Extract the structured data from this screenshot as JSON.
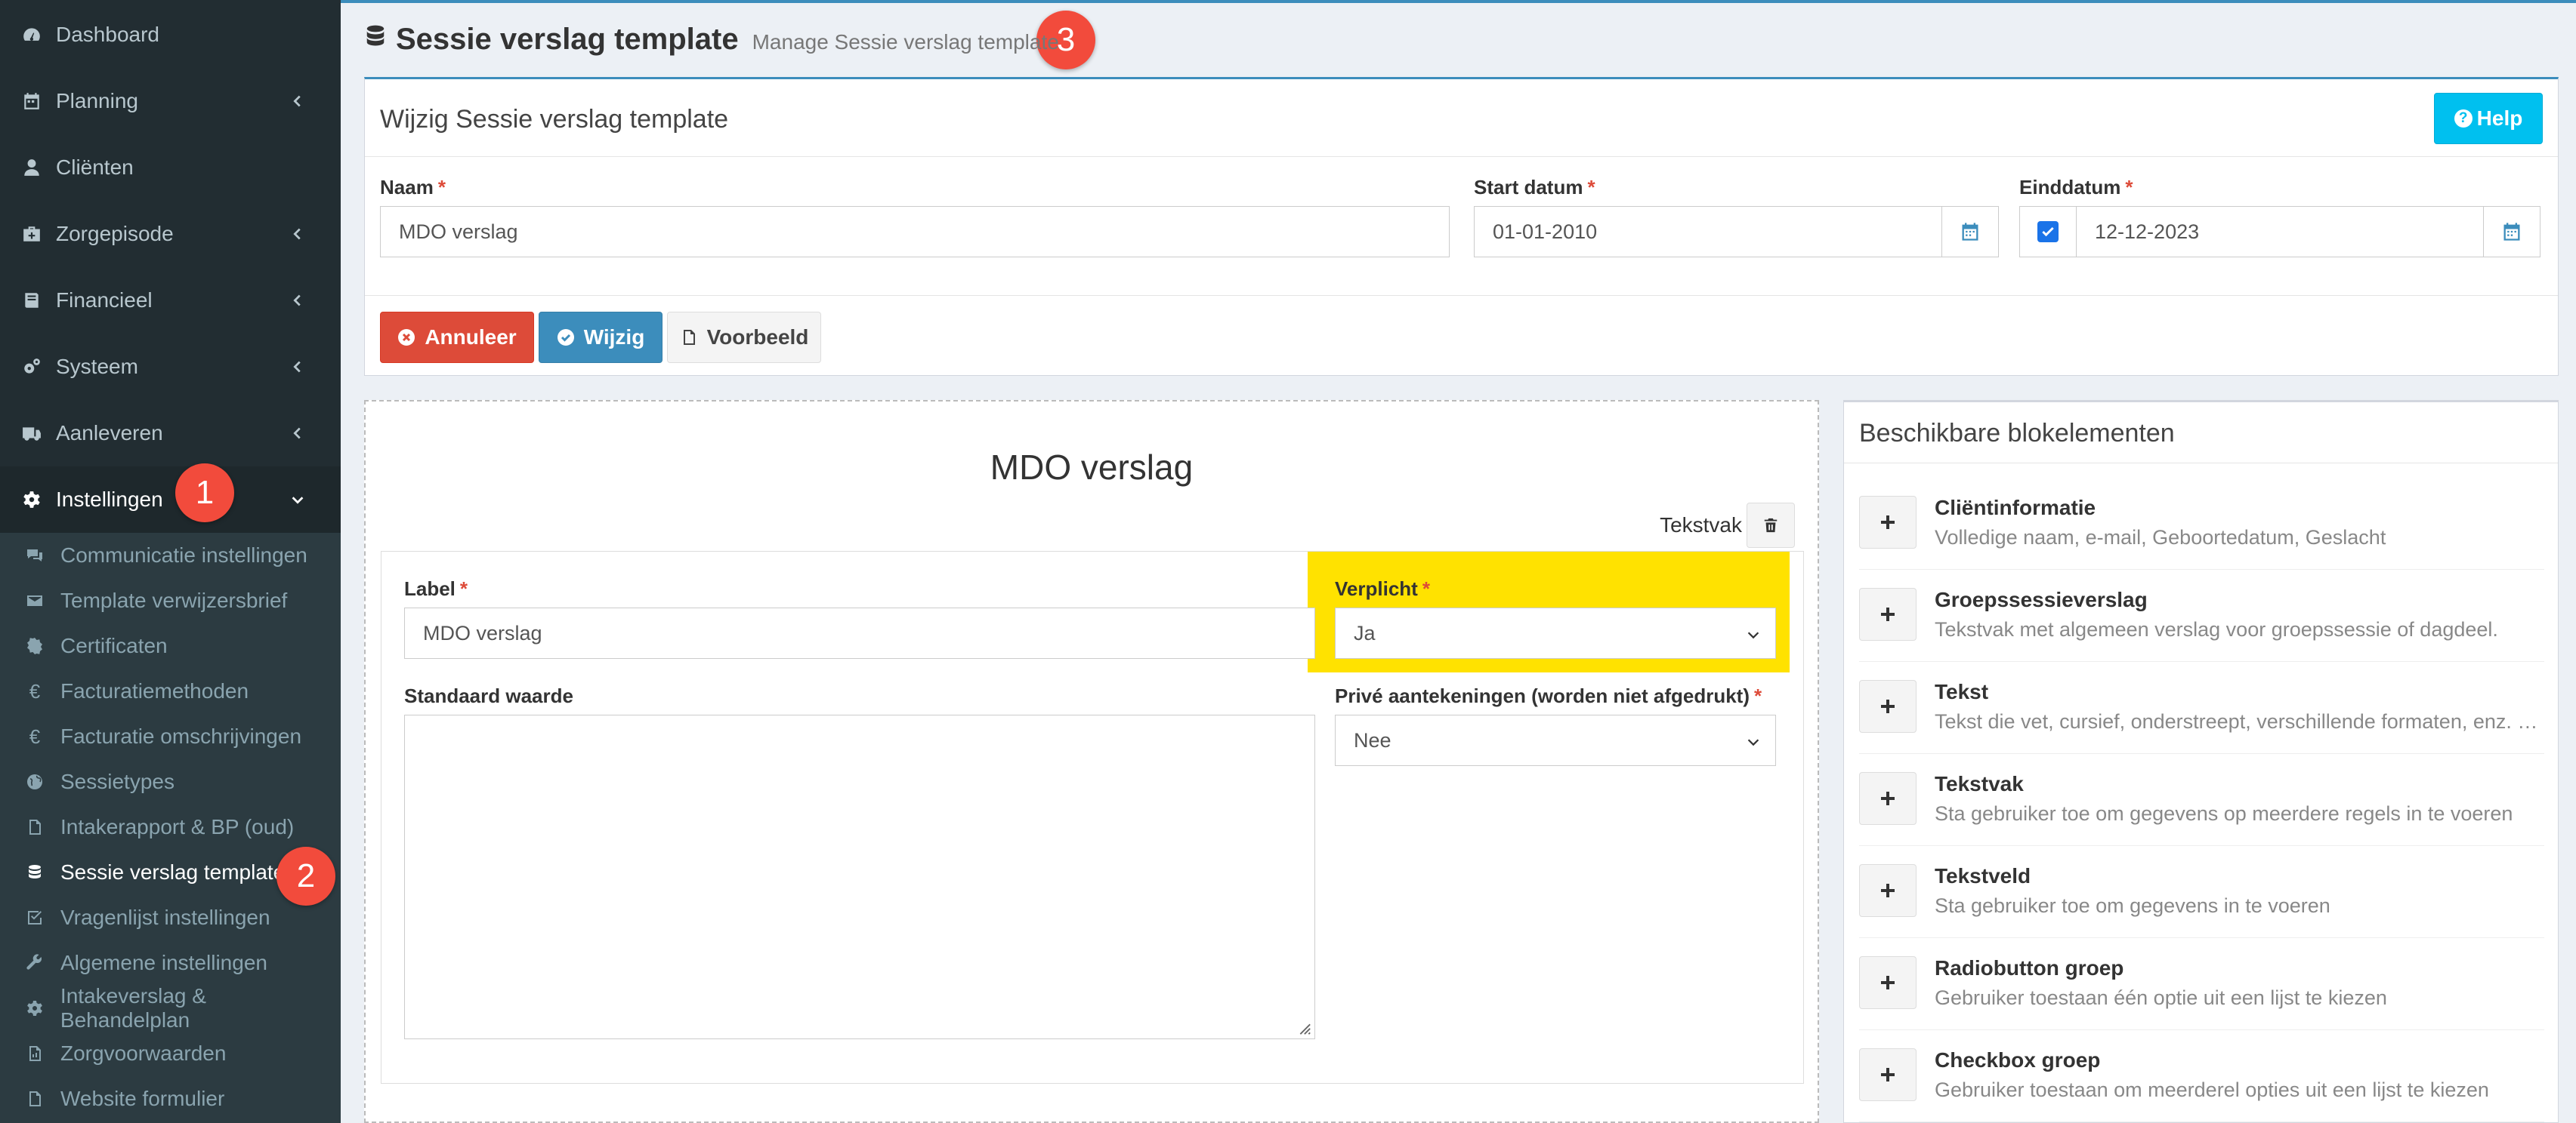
{
  "sidebar": {
    "items": [
      {
        "label": "Dashboard",
        "icon": "dashboard-icon",
        "chevron": false
      },
      {
        "label": "Planning",
        "icon": "calendar-icon",
        "chevron": true
      },
      {
        "label": "Cliënten",
        "icon": "user-icon",
        "chevron": false
      },
      {
        "label": "Zorgepisode",
        "icon": "medkit-icon",
        "chevron": true
      },
      {
        "label": "Financieel",
        "icon": "book-icon",
        "chevron": true
      },
      {
        "label": "Systeem",
        "icon": "cogs-icon",
        "chevron": true
      },
      {
        "label": "Aanleveren",
        "icon": "truck-icon",
        "chevron": true
      },
      {
        "label": "Instellingen",
        "icon": "gear-icon",
        "chevron": true,
        "active": true
      }
    ],
    "subitems": [
      {
        "label": "Communicatie instellingen",
        "icon": "comments-icon"
      },
      {
        "label": "Template verwijzersbrief",
        "icon": "envelope-icon"
      },
      {
        "label": "Certificaten",
        "icon": "certificate-icon"
      },
      {
        "label": "Facturatiemethoden",
        "icon": "euro-icon"
      },
      {
        "label": "Facturatie omschrijvingen",
        "icon": "euro-icon"
      },
      {
        "label": "Sessietypes",
        "icon": "globe-icon"
      },
      {
        "label": "Intakerapport & BP (oud)",
        "icon": "file-icon"
      },
      {
        "label": "Sessie verslag template",
        "icon": "database-icon",
        "active": true
      },
      {
        "label": "Vragenlijst instellingen",
        "icon": "check-square-icon"
      },
      {
        "label": "Algemene instellingen",
        "icon": "wrench-icon"
      },
      {
        "label": "Intakeverslag & Behandelplan",
        "icon": "gear-icon"
      },
      {
        "label": "Zorgvoorwaarden",
        "icon": "pdf-icon"
      },
      {
        "label": "Website formulier",
        "icon": "file-icon"
      }
    ]
  },
  "badges": {
    "one": "1",
    "two": "2",
    "three": "3",
    "color": "#f24b3c"
  },
  "header": {
    "title": "Sessie verslag template",
    "subtitle": "Manage Sessie verslag template"
  },
  "form": {
    "box_title": "Wijzig Sessie verslag template",
    "help_label": "Help",
    "naam_label": "Naam",
    "naam_value": "MDO verslag",
    "start_label": "Start datum",
    "start_value": "01-01-2010",
    "eind_label": "Einddatum",
    "eind_value": "12-12-2023",
    "eind_checked": true,
    "required_mark": "*",
    "cancel_label": "Annuleer",
    "save_label": "Wijzig",
    "preview_label": "Voorbeeld"
  },
  "editor": {
    "doc_title": "MDO verslag",
    "block_type": "Tekstvak",
    "label_label": "Label",
    "label_value": "MDO verslag",
    "verplicht_label": "Verplicht",
    "verplicht_value": "Ja",
    "standaard_label": "Standaard waarde",
    "standaard_value": "",
    "prive_label": "Privé aantekeningen (worden niet afgedrukt)",
    "prive_value": "Nee",
    "highlight_color": "#ffe200"
  },
  "available": {
    "title": "Beschikbare blokelementen",
    "items": [
      {
        "name": "Cliëntinformatie",
        "desc": "Volledige naam, e-mail, Geboortedatum, Geslacht"
      },
      {
        "name": "Groepssessieverslag",
        "desc": "Tekstvak met algemeen verslag voor groepssessie of dagdeel."
      },
      {
        "name": "Tekst",
        "desc": "Tekst die vet, cursief, onderstreept, verschillende formaten, enz. kan hebben"
      },
      {
        "name": "Tekstvak",
        "desc": "Sta gebruiker toe om gegevens op meerdere regels in te voeren"
      },
      {
        "name": "Tekstveld",
        "desc": "Sta gebruiker toe om gegevens in te voeren"
      },
      {
        "name": "Radiobutton groep",
        "desc": "Gebruiker toestaan één optie uit een lijst te kiezen"
      },
      {
        "name": "Checkbox groep",
        "desc": "Gebruiker toestaan om meerderel opties uit een lijst te kiezen"
      }
    ]
  },
  "colors": {
    "sidebar": "#222d32",
    "primary": "#3c8dbc",
    "danger": "#dd4b39",
    "info": "#00c0ef"
  }
}
